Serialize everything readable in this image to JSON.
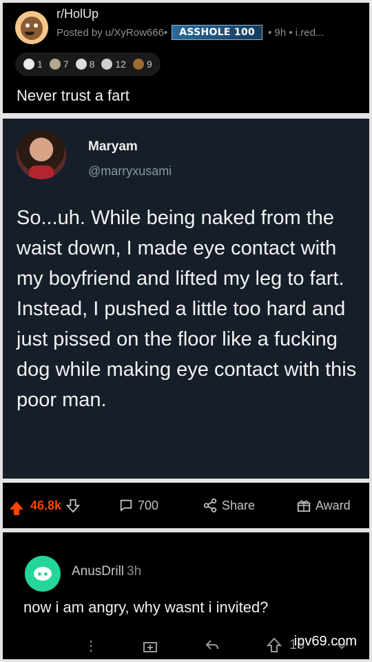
{
  "post": {
    "subreddit": "r/HolUp",
    "posted_by": "Posted by u/XyRow666•",
    "flair": "ASSHOLE 100",
    "meta": "• 9h • i.red...",
    "awards": [
      {
        "icon": "award-icon-1",
        "count": "1",
        "color": "#e9e9e9"
      },
      {
        "icon": "award-icon-2",
        "count": "7",
        "color": "#b0a78f"
      },
      {
        "icon": "award-icon-3",
        "count": "8",
        "color": "#dcdcdc"
      },
      {
        "icon": "award-icon-4",
        "count": "12",
        "color": "#cfcfcf"
      },
      {
        "icon": "award-icon-5",
        "count": "9",
        "color": "#9b6b33"
      }
    ],
    "title": "Never trust a fart"
  },
  "tweet": {
    "name": "Maryam",
    "handle": "@marryxusami",
    "text": "So...uh. While being naked from the waist down, I made eye contact with my boyfriend and lifted my leg to fart. Instead, I pushed a little too hard and just pissed on the floor like a fucking dog while making eye contact with this poor man."
  },
  "actions": {
    "score": "46.8k",
    "comments": "700",
    "share": "Share",
    "award": "Award"
  },
  "comment": {
    "user": "AnusDrill",
    "time": "3h",
    "text": "now i am angry, why wasnt i invited?",
    "count_partial": "15"
  },
  "watermark": "ipv69.com",
  "colors": {
    "accent": "#ff4500",
    "panel": "#000000",
    "tweet_bg": "#161f29"
  }
}
